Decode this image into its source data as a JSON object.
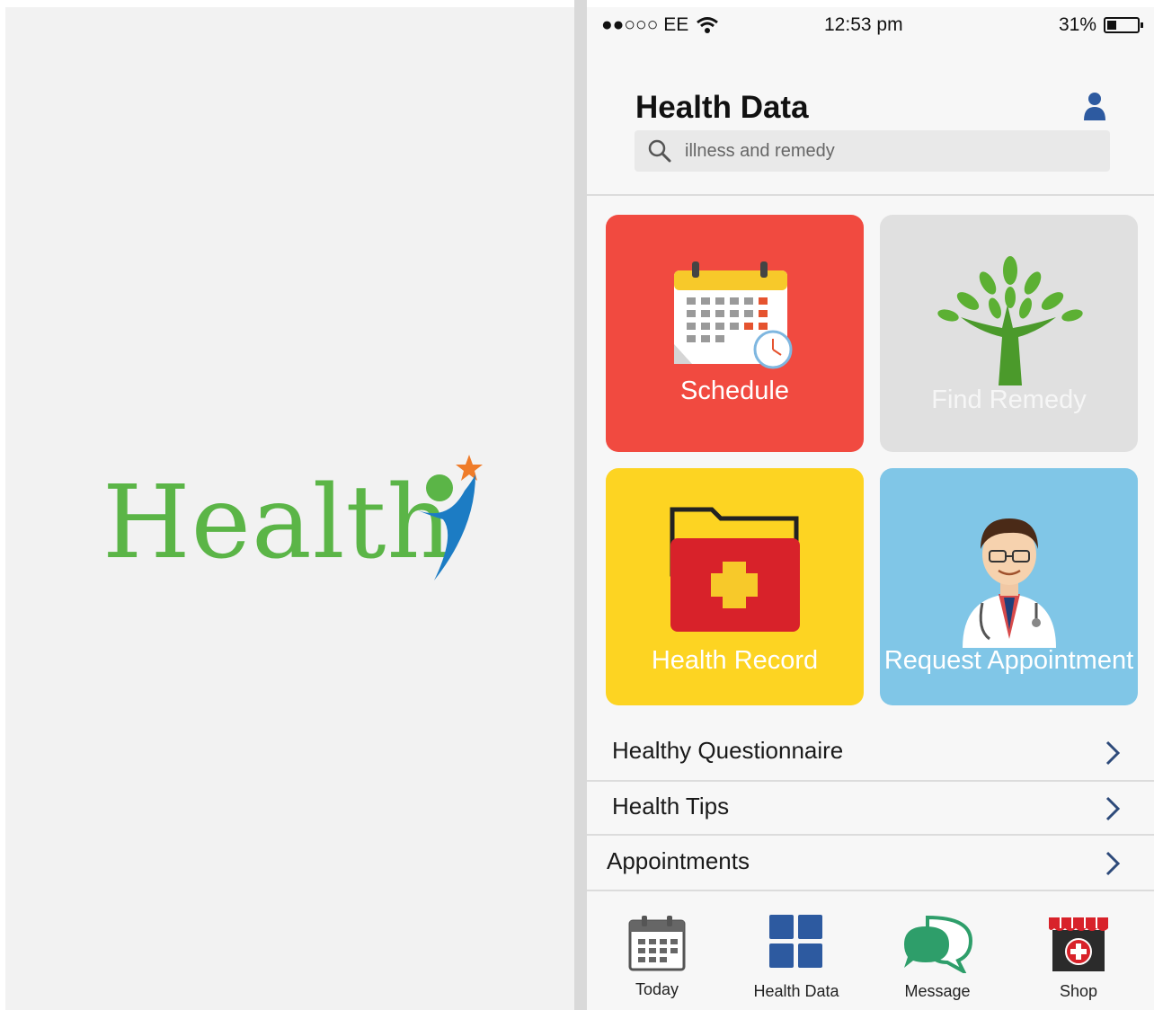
{
  "splash": {
    "logo_text": "Health"
  },
  "status_bar": {
    "carrier": "●●○○○ EE",
    "time": "12:53 pm",
    "battery_text": "31%",
    "battery_level": 0.31
  },
  "header": {
    "title": "Health Data"
  },
  "search": {
    "placeholder": "illness and remedy"
  },
  "tiles": [
    {
      "label": "Schedule"
    },
    {
      "label": "Find Remedy"
    },
    {
      "label": "Health Record"
    },
    {
      "label": "Request Appointment"
    }
  ],
  "menu": [
    {
      "label": "Healthy Questionnaire"
    },
    {
      "label": "Health Tips"
    },
    {
      "label": "Appointments"
    }
  ],
  "tabbar": [
    {
      "label": "Today",
      "icon": "calendar-icon"
    },
    {
      "label": "Health Data",
      "icon": "grid-icon"
    },
    {
      "label": "Message",
      "icon": "chat-bubbles-icon"
    },
    {
      "label": "Shop",
      "icon": "storefront-icon"
    }
  ],
  "colors": {
    "logo_green": "#5bb547",
    "schedule": "#f14a40",
    "remedy": "#e0e0e0",
    "record": "#fdd422",
    "appointment": "#80c6e7",
    "tab_blue": "#2d5aa0",
    "message_green": "#2e9e6a",
    "shop_red": "#d8222a"
  }
}
